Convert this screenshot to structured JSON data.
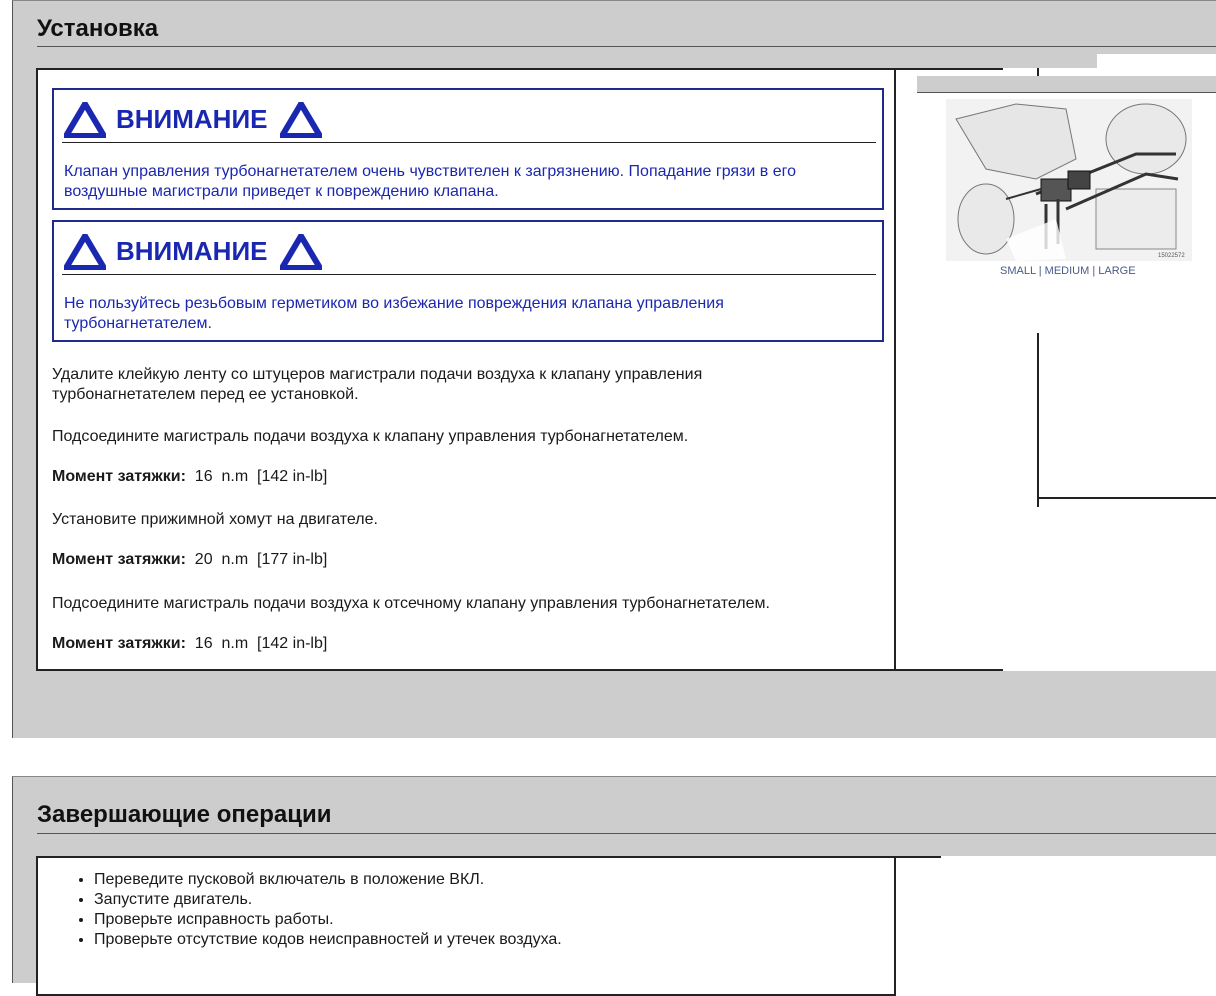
{
  "installation": {
    "title": "Установка",
    "warnings": [
      {
        "heading": "ВНИМАНИЕ",
        "text": "Клапан управления турбонагнетателем очень чувствителен к загрязнению. Попадание грязи в его воздушные магистрали приведет к повреждению клапана."
      },
      {
        "heading": "ВНИМАНИЕ",
        "text": "Не пользуйтесь резьбовым герметиком во избежание повреждения клапана управления турбонагнетателем."
      }
    ],
    "steps": [
      "Удалите клейкую ленту со штуцеров магистрали подачи воздуха к клапану управления турбонагнетателем перед ее установкой.",
      "Подсоедините магистраль подачи воздуха к клапану управления турбонагнетателем.",
      "Установите прижимной хомут на двигателе.",
      "Подсоедините магистраль подачи воздуха к отсечному клапану управления турбонагнетателем."
    ],
    "torque_label": "Момент затяжки:",
    "torques": [
      {
        "value": "16",
        "unit": "n.m",
        "alt": "[142 in-lb]"
      },
      {
        "value": "20",
        "unit": "n.m",
        "alt": "[177 in-lb]"
      },
      {
        "value": "16",
        "unit": "n.m",
        "alt": "[142 in-lb]"
      }
    ],
    "figure": {
      "code": "15022572",
      "links": [
        "SMALL",
        "MEDIUM",
        "LARGE"
      ],
      "separator": "|"
    }
  },
  "completion": {
    "title": "Завершающие операции",
    "items": [
      "Переведите пусковой включатель в положение ВКЛ.",
      "Запустите двигатель.",
      "Проверьте исправность работы.",
      "Проверьте отсутствие кодов неисправностей и утечек воздуха."
    ]
  },
  "colors": {
    "section_bg": "#cdcdcd",
    "warning_blue": "#1a27b0",
    "warning_border": "#1f2a8a"
  }
}
